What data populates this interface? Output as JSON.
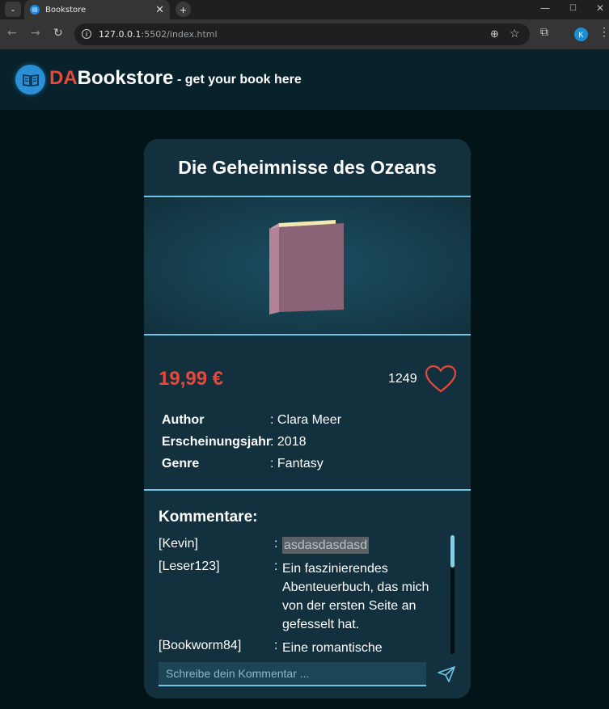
{
  "browser": {
    "tab_title": "Bookstore",
    "url_host": "127.0.0.1",
    "url_rest": ":5502/index.html",
    "profile_initial": "K"
  },
  "header": {
    "brand_prefix": "DA",
    "brand_name": "Bookstore",
    "tagline": "- get your book here"
  },
  "book": {
    "title": "Die Geheimnisse des Ozeans",
    "price": "19,99 €",
    "likes": "1249",
    "details": [
      {
        "label": "Author",
        "value": ": Clara Meer"
      },
      {
        "label": "Erscheinungsjahr",
        "value": ": 2018"
      },
      {
        "label": "Genre",
        "value": ": Fantasy"
      }
    ]
  },
  "comments": {
    "heading": "Kommentare:",
    "items": [
      {
        "user": "[Kevin]",
        "text": "asdasdasdasd"
      },
      {
        "user": "[Leser123]",
        "text": "Ein faszinierendes Abenteuerbuch, das mich von der ersten Seite an gefesselt hat."
      },
      {
        "user": "[Bookworm84]",
        "text": "Eine romantische"
      }
    ],
    "input_placeholder": "Schreibe dein Kommentar ..."
  },
  "colors": {
    "accent_red": "#e8483a",
    "divider_blue": "#6ec6e6",
    "card_bg": "#12303d",
    "page_bg": "#031419"
  },
  "icons": [
    "tab-list-icon",
    "favicon-icon",
    "close-icon",
    "plus-icon",
    "back-arrow-icon",
    "forward-arrow-icon",
    "reload-icon",
    "info-icon",
    "zoom-icon",
    "star-icon",
    "extensions-icon",
    "kebab-menu-icon",
    "book-logo-icon",
    "heart-icon",
    "send-icon"
  ]
}
